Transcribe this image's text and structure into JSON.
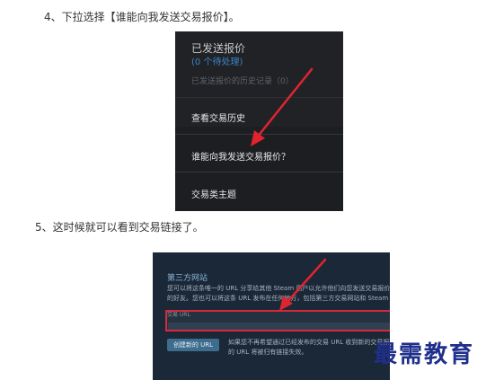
{
  "steps": {
    "step4": "4、下拉选择【谁能向我发送交易报价】。",
    "step5": "5、这时候就可以看到交易链接了。"
  },
  "dropdown": {
    "title": "已发送报价",
    "pending": "(0 个待处理)",
    "history": "已发送报价的历史记录（0）",
    "items": [
      "查看交易历史",
      "谁能向我发送交易报价？",
      "交易类主题"
    ]
  },
  "third_party": {
    "title": "第三方网站",
    "desc_line1": "您可以将这条唯一的 URL 分享给其他 Steam 用户以允许他们向您发送交易报价，即使他们不是您",
    "desc_line2": "的好友。您也可以将这条 URL 发布在任何地方，包括第三方交易网站和 Steam 社区论坛。",
    "url_label": "交易 URL",
    "new_url_button": "创建新的 URL",
    "note_line1": "如果您不再希望通过已经发布的交易 URL 收到新的交易报价，请点击此按钮。您先前",
    "note_line2": "的 URL 将被归有链接失效。"
  },
  "watermark": "最需教育",
  "colors": {
    "arrow": "#e0242f",
    "highlight_border": "#d8283a",
    "watermark": "#1f2f8c"
  }
}
